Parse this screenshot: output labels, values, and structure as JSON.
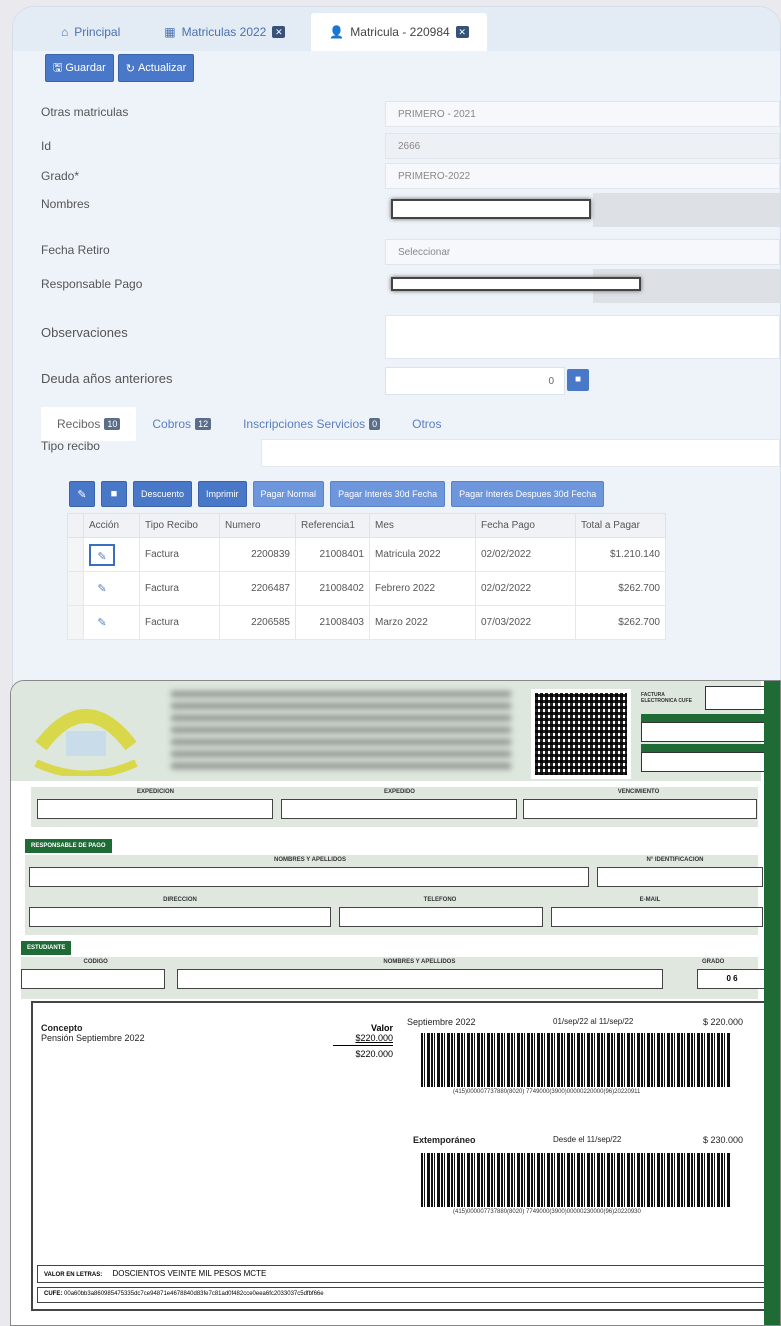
{
  "tabs": [
    {
      "icon": "home-icon",
      "label": "Principal",
      "active": false
    },
    {
      "icon": "table-icon",
      "label": "Matriculas 2022",
      "active": false
    },
    {
      "icon": "user-icon",
      "label": "Matricula - 220984",
      "active": true
    }
  ],
  "toolbar": {
    "save_label": "Guardar",
    "refresh_label": "Actualizar"
  },
  "form": {
    "otras_matriculas": {
      "label": "Otras matriculas",
      "value": "PRIMERO - 2021"
    },
    "id": {
      "label": "Id",
      "value": "2666"
    },
    "grado": {
      "label": "Grado*",
      "value": "PRIMERO-2022"
    },
    "nombres": {
      "label": "Nombres"
    },
    "fecha_retiro": {
      "label": "Fecha Retiro",
      "placeholder": "Seleccionar"
    },
    "responsable": {
      "label": "Responsable Pago"
    },
    "observaciones": {
      "label": "Observaciones"
    },
    "deuda": {
      "label": "Deuda años anteriores",
      "value": "0"
    }
  },
  "subtabs": [
    {
      "label": "Recibos",
      "badge": "10",
      "active": true
    },
    {
      "label": "Cobros",
      "badge": "12",
      "active": false
    },
    {
      "label": "Inscripciones Servicios",
      "badge": "0",
      "active": false
    },
    {
      "label": "Otros",
      "badge": "",
      "active": false
    }
  ],
  "tipo_recibo_label": "Tipo recibo",
  "actions": [
    "Descuento",
    "Imprimir",
    "Pagar Normal",
    "Pagar Interés 30d Fecha",
    "Pagar Interés Despues 30d Fecha"
  ],
  "table": {
    "headers": [
      "Acción",
      "Tipo Recibo",
      "Numero",
      "Referencia1",
      "Mes",
      "Fecha Pago",
      "Total a Pagar"
    ],
    "rows": [
      {
        "tipo": "Factura",
        "numero": "2200839",
        "ref": "21008401",
        "mes": "Matricula 2022",
        "fecha": "02/02/2022",
        "total": "$1.210.140"
      },
      {
        "tipo": "Factura",
        "numero": "2206487",
        "ref": "21008402",
        "mes": "Febrero 2022",
        "fecha": "02/02/2022",
        "total": "$262.700"
      },
      {
        "tipo": "Factura",
        "numero": "2206585",
        "ref": "21008403",
        "mes": "Marzo 2022",
        "fecha": "07/03/2022",
        "total": "$262.700"
      }
    ]
  },
  "invoice": {
    "factura_label": "FACTURA ELECTRONICA CUFE",
    "sections": {
      "row1": [
        "EXPEDICION",
        "EXPEDIDO",
        "VENCIMIENTO"
      ],
      "responsable_label": "RESPONSABLE DE PAGO",
      "row2": [
        "NOMBRES Y APELLIDOS",
        "N° IDENTIFICACION"
      ],
      "row3": [
        "DIRECCION",
        "TELEFONO",
        "E-MAIL"
      ],
      "estudiante_label": "ESTUDIANTE",
      "row4": [
        "CODIGO",
        "NOMBRES Y APELLIDOS",
        "GRADO"
      ],
      "grado_value": "0 6"
    },
    "concepto_header": "Concepto",
    "concepto_item": "Pensión Septiembre 2022",
    "valor_header": "Valor",
    "valor_item": "$220.000",
    "valor_total": "$220.000",
    "pay1": {
      "label": "Septiembre 2022",
      "range": "01/sep/22 al 11/sep/22",
      "amount": "$ 220.000"
    },
    "pay2": {
      "label": "Extemporáneo",
      "range": "Desde el 11/sep/22",
      "amount": "$ 230.000"
    },
    "barcode_text": "(415)000007737880(8020) 7749000(3900)00000220000(96)20220911",
    "barcode_text2": "(415)000007737880(8020) 7749000(3900)00000230000(96)20220930",
    "letters_label": "VALOR EN LETRAS:",
    "letters_value": "DOSCIENTOS VEINTE MIL PESOS MCTE",
    "cufe_label": "CUFE:",
    "cufe_value": "00a60bb3a860985475335dc7ce94871e4678840d83fe7c81ad0f482cce0eea6fc2033037c5dfbf66e"
  }
}
